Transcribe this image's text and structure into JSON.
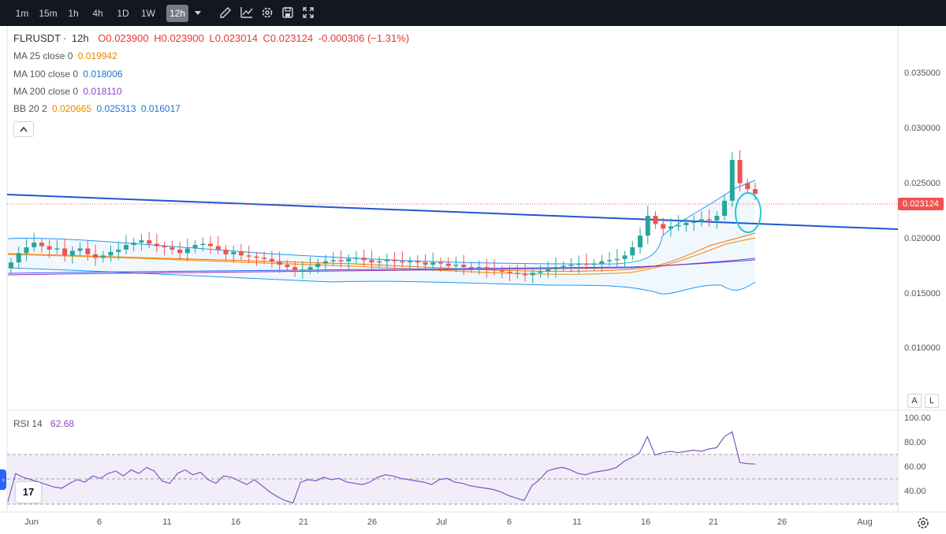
{
  "toolbar": {
    "intervals": [
      "1m",
      "15m",
      "1h",
      "4h",
      "1D",
      "1W",
      "12h"
    ],
    "active_interval": "12h",
    "icons": [
      "dropdown-caret-icon",
      "draw-icon",
      "indicators-icon",
      "settings-icon",
      "save-icon",
      "fullscreen-icon"
    ]
  },
  "legend": {
    "symbol": "FLRUSDT",
    "interval": "12h",
    "open": "O0.023900",
    "high": "H0.023900",
    "low": "L0.023014",
    "close": "C0.023124",
    "change": "-0.000306 (−1.31%)",
    "ma25_label": "MA 25 close 0",
    "ma25_value": "0.019942",
    "ma100_label": "MA 100 close 0",
    "ma100_value": "0.018006",
    "ma200_label": "MA 200 close 0",
    "ma200_value": "0.018110",
    "bb_label": "BB 20 2",
    "bb_basis": "0.020665",
    "bb_upper": "0.025313",
    "bb_lower": "0.016017",
    "rsi_label": "RSI 14",
    "rsi_value": "62.68"
  },
  "price_axis": [
    "0.035000",
    "0.030000",
    "0.025000",
    "0.020000",
    "0.015000",
    "0.010000"
  ],
  "last_price": "0.023124",
  "rsi_axis": [
    "100.00",
    "80.00",
    "60.00",
    "40.00"
  ],
  "time_axis": [
    "Jun",
    "6",
    "11",
    "16",
    "21",
    "26",
    "Jul",
    "6",
    "11",
    "16",
    "21",
    "26",
    "Aug"
  ],
  "scale_buttons": {
    "auto": "A",
    "log": "L"
  },
  "logo_text": "17",
  "colors": {
    "up": "#26a69a",
    "down": "#ef5350",
    "ma25": "#e08a00",
    "ma100": "#1e73c7",
    "ma200": "#8e44c7",
    "bb": "#2196f3",
    "trendline": "#2255d4",
    "rsi": "#7e57c2"
  },
  "chart_data": {
    "type": "candlestick",
    "symbol": "FLRUSDT",
    "interval": "12h",
    "ylim": [
      0.0045,
      0.0375
    ],
    "last_close": 0.023124,
    "closes": [
      0.0172,
      0.018,
      0.0185,
      0.0189,
      0.0186,
      0.0183,
      0.0184,
      0.0178,
      0.0182,
      0.0184,
      0.0179,
      0.0176,
      0.0178,
      0.0181,
      0.0183,
      0.0187,
      0.0189,
      0.0191,
      0.0188,
      0.0186,
      0.0185,
      0.0183,
      0.018,
      0.0184,
      0.0187,
      0.0188,
      0.0186,
      0.0183,
      0.0179,
      0.0181,
      0.0178,
      0.0177,
      0.0176,
      0.0175,
      0.0173,
      0.017,
      0.0168,
      0.0165,
      0.0166,
      0.0168,
      0.0171,
      0.0173,
      0.0174,
      0.0173,
      0.0175,
      0.0176,
      0.0174,
      0.0172,
      0.0173,
      0.0174,
      0.0173,
      0.0172,
      0.0173,
      0.0172,
      0.017,
      0.0172,
      0.0171,
      0.0169,
      0.017,
      0.0168,
      0.0167,
      0.0168,
      0.0166,
      0.0165,
      0.0164,
      0.0163,
      0.0162,
      0.0161,
      0.0163,
      0.0164,
      0.0166,
      0.0168,
      0.0169,
      0.017,
      0.0171,
      0.017,
      0.0171,
      0.0173,
      0.0174,
      0.0175,
      0.0178,
      0.0185,
      0.0195,
      0.0212,
      0.0205,
      0.0201,
      0.0203,
      0.0204,
      0.0206,
      0.0207,
      0.0209,
      0.0208,
      0.0212,
      0.0225,
      0.026,
      0.024,
      0.0235,
      0.0231
    ],
    "rsi": [
      32,
      55,
      52,
      50,
      48,
      46,
      44,
      43,
      47,
      50,
      48,
      53,
      51,
      55,
      57,
      53,
      58,
      55,
      60,
      57,
      49,
      47,
      55,
      58,
      54,
      56,
      50,
      47,
      53,
      52,
      49,
      46,
      50,
      45,
      40,
      36,
      33,
      31,
      48,
      50,
      49,
      52,
      50,
      51,
      48,
      47,
      46,
      48,
      52,
      54,
      53,
      51,
      50,
      49,
      48,
      46,
      50,
      51,
      48,
      47,
      45,
      44,
      43,
      42,
      40,
      37,
      35,
      33,
      45,
      50,
      57,
      59,
      60,
      58,
      55,
      54,
      56,
      57,
      58,
      60,
      65,
      68,
      72,
      85,
      70,
      72,
      73,
      72,
      73,
      74,
      73,
      75,
      76,
      85,
      89,
      64,
      63,
      62.68
    ],
    "indicators": {
      "ma25": 0.019942,
      "ma100": 0.018006,
      "ma200": 0.01811,
      "bb_basis": 0.020665,
      "bb_upper": 0.025313,
      "bb_lower": 0.016017
    },
    "rsi_levels": [
      70,
      50,
      30
    ],
    "x_ticks": [
      "Jun",
      "6",
      "11",
      "16",
      "21",
      "26",
      "Jul",
      "6",
      "11",
      "16",
      "21",
      "26",
      "Aug"
    ],
    "annotations": [
      "descending-trendline",
      "highlight-circle"
    ]
  }
}
